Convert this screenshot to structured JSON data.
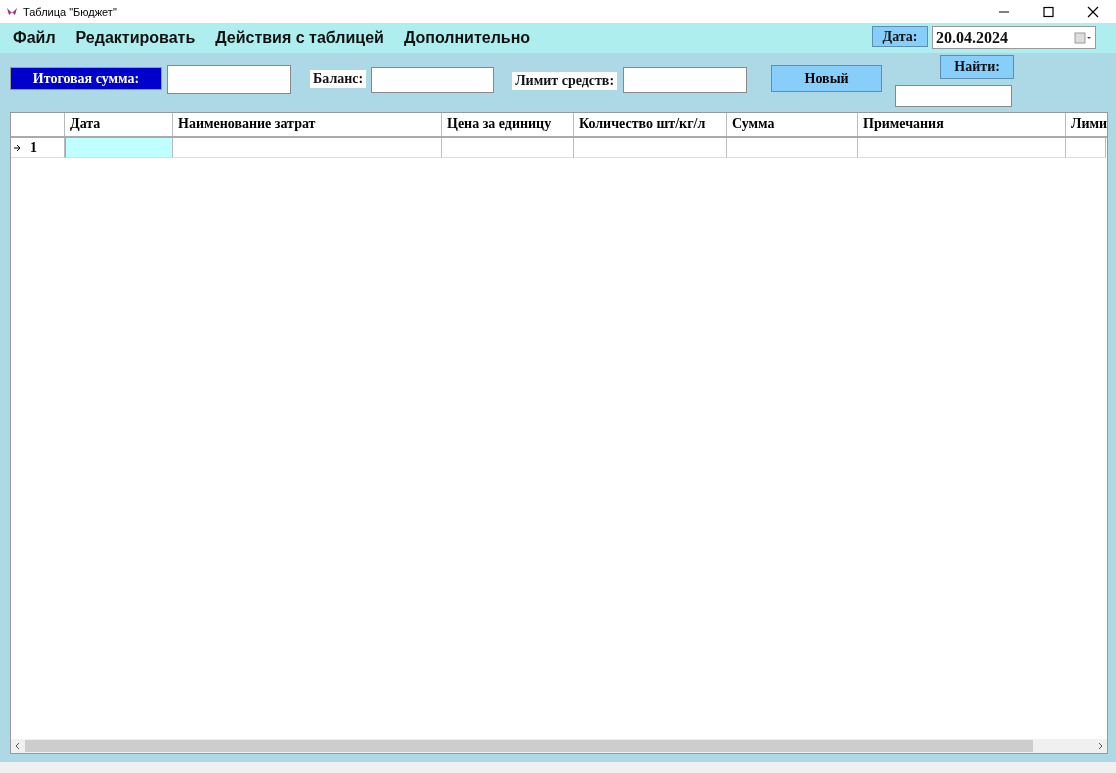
{
  "window": {
    "title": "Таблица \"Бюджет\""
  },
  "menu": [
    {
      "label": "Файл"
    },
    {
      "label": "Редактировать"
    },
    {
      "label": "Действия с таблицей"
    },
    {
      "label": "Дополнительно"
    }
  ],
  "date": {
    "label": "Дата:",
    "value": "20.04.2024"
  },
  "toolbar": {
    "total_label": "Итоговая сумма:",
    "balance_label": "Баланс:",
    "limit_label": "Лимит средств:",
    "new_button": "Новый",
    "find_label": "Найти:"
  },
  "table": {
    "columns": [
      "Дата",
      "Наименование затрат",
      "Цена за единицу",
      "Количество шт/кг/л",
      "Сумма",
      "Примечания",
      "Лими"
    ],
    "rows": [
      {
        "header": "1",
        "current": true
      }
    ]
  }
}
